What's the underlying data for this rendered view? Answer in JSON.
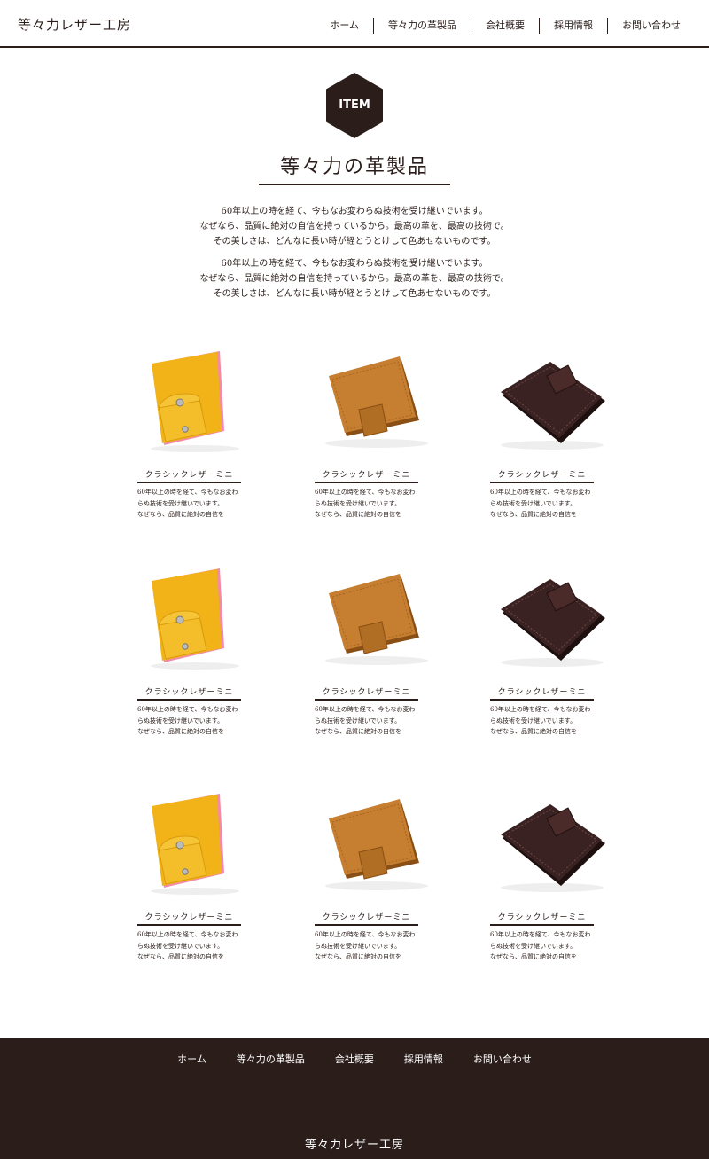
{
  "header": {
    "brand": "等々力レザー工房",
    "nav": [
      "ホーム",
      "等々力の革製品",
      "会社概要",
      "採用情報",
      "お問い合わせ"
    ]
  },
  "hero": {
    "badge": "ITEM",
    "title": "等々力の革製品",
    "paragraphs": [
      [
        "60年以上の時を経て、今もなお変わらぬ技術を受け継いでいます。",
        "なぜなら、品質に絶対の自信を持っているから。最高の革を、最高の技術で。",
        "その美しさは、どんなに長い時が経とうとけして色あせないものです。"
      ],
      [
        "60年以上の時を経て、今もなお変わらぬ技術を受け継いでいます。",
        "なぜなら、品質に絶対の自信を持っているから。最高の革を、最高の技術で。",
        "その美しさは、どんなに長い時が経とうとけして色あせないものです。"
      ]
    ]
  },
  "products": [
    {
      "image": "yellow-wallet",
      "name": "クラシックレザーミニ",
      "desc": [
        "60年以上の時を経て、今もなお変わ",
        "らぬ技術を受け継いでいます。",
        "なぜなら、品質に絶対の自信を"
      ]
    },
    {
      "image": "tan-wallet",
      "name": "クラシックレザーミニ",
      "desc": [
        "60年以上の時を経て、今もなお変わ",
        "らぬ技術を受け継いでいます。",
        "なぜなら、品質に絶対の自信を"
      ]
    },
    {
      "image": "brown-wallet",
      "name": "クラシックレザーミニ",
      "desc": [
        "60年以上の時を経て、今もなお変わ",
        "らぬ技術を受け継いでいます。",
        "なぜなら、品質に絶対の自信を"
      ]
    },
    {
      "image": "yellow-wallet",
      "name": "クラシックレザーミニ",
      "desc": [
        "60年以上の時を経て、今もなお変わ",
        "らぬ技術を受け継いでいます。",
        "なぜなら、品質に絶対の自信を"
      ]
    },
    {
      "image": "tan-wallet",
      "name": "クラシックレザーミニ",
      "desc": [
        "60年以上の時を経て、今もなお変わ",
        "らぬ技術を受け継いでいます。",
        "なぜなら、品質に絶対の自信を"
      ]
    },
    {
      "image": "brown-wallet",
      "name": "クラシックレザーミニ",
      "desc": [
        "60年以上の時を経て、今もなお変わ",
        "らぬ技術を受け継いでいます。",
        "なぜなら、品質に絶対の自信を"
      ]
    },
    {
      "image": "yellow-wallet",
      "name": "クラシックレザーミニ",
      "desc": [
        "60年以上の時を経て、今もなお変わ",
        "らぬ技術を受け継いでいます。",
        "なぜなら、品質に絶対の自信を"
      ]
    },
    {
      "image": "tan-wallet",
      "name": "クラシックレザーミニ",
      "desc": [
        "60年以上の時を経て、今もなお変わ",
        "らぬ技術を受け継いでいます。",
        "なぜなら、品質に絶対の自信を"
      ]
    },
    {
      "image": "brown-wallet",
      "name": "クラシックレザーミニ",
      "desc": [
        "60年以上の時を経て、今もなお変わ",
        "らぬ技術を受け継いでいます。",
        "なぜなら、品質に絶対の自信を"
      ]
    }
  ],
  "footer": {
    "nav": [
      "ホーム",
      "等々力の革製品",
      "会社概要",
      "採用情報",
      "お問い合わせ"
    ],
    "brand": "等々力レザー工房"
  },
  "colors": {
    "dark_brown": "#2a1d1a",
    "yellow": "#f2b318",
    "pink": "#f28aa8",
    "tan": "#c47a2c",
    "dark_leather": "#3b2222"
  }
}
